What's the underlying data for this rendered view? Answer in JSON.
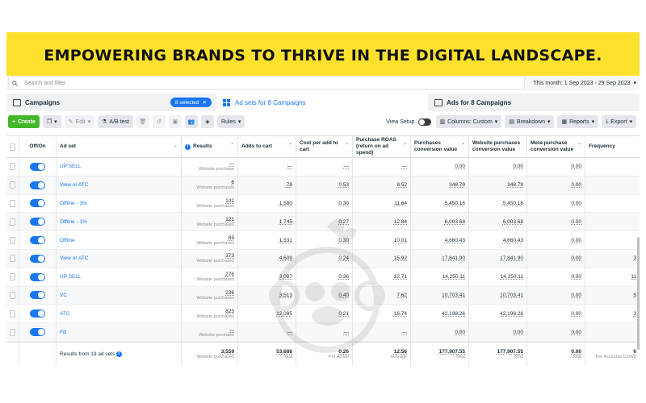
{
  "banner": {
    "title": "EMPOWERING BRANDS TO THRIVE IN THE DIGITAL LANDSCAPE."
  },
  "search": {
    "placeholder": "Search and filter",
    "date_range": "This month: 1 Sep 2023 - 29 Sep 2023"
  },
  "tabs": {
    "campaigns": "Campaigns",
    "selected_badge": "8 selected",
    "adsets": "Ad sets for 8 Campaigns",
    "ads": "Ads for 8 Campaigns"
  },
  "toolbar": {
    "create": "Create",
    "edit": "Edit",
    "ab_test": "A/B test",
    "rules": "Rules",
    "view_setup": "View Setup",
    "columns": "Columns: Custom",
    "breakdown": "Breakdown",
    "reports": "Reports",
    "export": "Export"
  },
  "columns": {
    "offon": "Off/On",
    "adset": "Ad set",
    "results": "Results",
    "add_to_cart": "Adds to cart",
    "cost_per_atc": "Cost per add to cart",
    "roas": "Purchase ROAS (return on ad spend)",
    "purchases_cv": "Purchases conversion value",
    "website_pcv": "Website purchases conversion value",
    "meta_pcv": "Meta purchase conversion value",
    "frequency": "Frequency"
  },
  "rows": [
    {
      "name": "UP SELL",
      "results": "—",
      "results_sub": "Website purchase",
      "atc": "—",
      "cpa": "—",
      "roas": "—",
      "pcv": "0.00",
      "wpcv": "0.00",
      "mpcv": "0.00",
      "freq": ""
    },
    {
      "name": "View or ATC",
      "results": "6",
      "results_sub": "Website purchases",
      "atc": "78",
      "cpa": "0.53",
      "roas": "8.52",
      "pcv": "348.79",
      "wpcv": "348.79",
      "mpcv": "0.00",
      "freq": ""
    },
    {
      "name": "Offline - 3%",
      "results": "102",
      "results_sub": "Website purchases",
      "atc": "1,580",
      "cpa": "0.30",
      "roas": "11.64",
      "pcv": "5,450.16",
      "wpcv": "5,450.16",
      "mpcv": "0.00",
      "freq": ""
    },
    {
      "name": "Offline - 1%",
      "results": "121",
      "results_sub": "Website purchases",
      "atc": "1,745",
      "cpa": "0.27",
      "roas": "12.84",
      "pcv": "6,003.68",
      "wpcv": "6,003.68",
      "mpcv": "0.00",
      "freq": ""
    },
    {
      "name": "Offline",
      "results": "89",
      "results_sub": "Website purchases",
      "atc": "1,531",
      "cpa": "0.30",
      "roas": "10.01",
      "pcv": "4,660.43",
      "wpcv": "4,660.43",
      "mpcv": "0.00",
      "freq": ""
    },
    {
      "name": "View or ATC",
      "results": "373",
      "results_sub": "Website purchases",
      "atc": "4,609",
      "cpa": "0.24",
      "roas": "15.92",
      "pcv": "17,841.90",
      "wpcv": "17,841.90",
      "mpcv": "0.00",
      "freq": "3"
    },
    {
      "name": "UP SELL",
      "results": "276",
      "results_sub": "Website purchases",
      "atc": "3,087",
      "cpa": "0.36",
      "roas": "12.71",
      "pcv": "14,250.11",
      "wpcv": "14,250.11",
      "mpcv": "0.00",
      "freq": "11"
    },
    {
      "name": "VC",
      "results": "236",
      "results_sub": "Website purchases",
      "atc": "3,513",
      "cpa": "0.40",
      "roas": "7.62",
      "pcv": "10,703.41",
      "wpcv": "10,703.41",
      "mpcv": "0.00",
      "freq": "5"
    },
    {
      "name": "ATC",
      "results": "825",
      "results_sub": "Website purchases",
      "atc": "12,085",
      "cpa": "0.21",
      "roas": "16.74",
      "pcv": "42,198.26",
      "wpcv": "42,198.26",
      "mpcv": "0.00",
      "freq": "3"
    },
    {
      "name": "FB",
      "results": "—",
      "results_sub": "Website purchase",
      "atc": "—",
      "cpa": "—",
      "roas": "—",
      "pcv": "0.00",
      "wpcv": "0.00",
      "mpcv": "0.00",
      "freq": ""
    }
  ],
  "footer": {
    "label": "Results from 19 ad sets",
    "results": "3,559",
    "results_sub": "Website purchases",
    "atc": "53,688",
    "atc_sub": "Total",
    "cpa": "0.26",
    "cpa_sub": "Per Action",
    "roas": "12.56",
    "roas_sub": "Average",
    "pcv": "177,907.55",
    "pcv_sub": "Total",
    "wpcv": "177,907.55",
    "wpcv_sub": "Total",
    "mpcv": "0.00",
    "mpcv_sub": "Total",
    "freq": "6",
    "freq_sub": "Per Accounts Centre"
  }
}
